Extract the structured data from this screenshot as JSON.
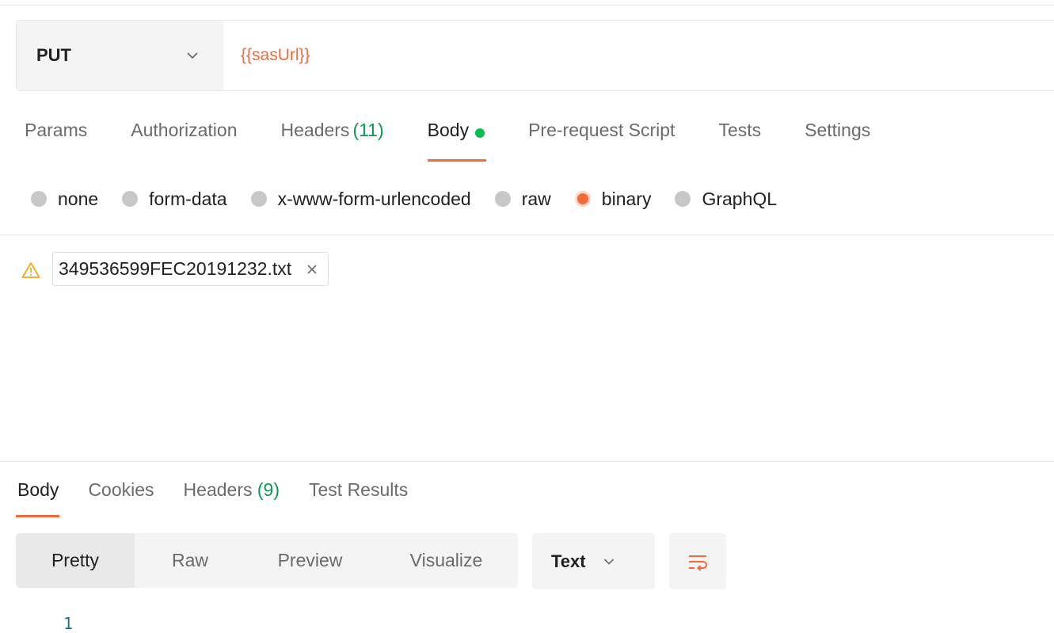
{
  "request": {
    "method": "PUT",
    "url": "{{sasUrl}}"
  },
  "request_tabs": [
    {
      "label": "Params",
      "count": ""
    },
    {
      "label": "Authorization",
      "count": ""
    },
    {
      "label": "Headers",
      "count": "(11)"
    },
    {
      "label": "Body",
      "count": "",
      "active": true
    },
    {
      "label": "Pre-request Script",
      "count": ""
    },
    {
      "label": "Tests",
      "count": ""
    },
    {
      "label": "Settings",
      "count": ""
    }
  ],
  "body_types": [
    "none",
    "form-data",
    "x-www-form-urlencoded",
    "raw",
    "binary",
    "GraphQL"
  ],
  "body_type_selected": "binary",
  "file": {
    "name": "349536599FEC20191232.txt"
  },
  "response_tabs": [
    {
      "label": "Body",
      "count": ""
    },
    {
      "label": "Cookies",
      "count": ""
    },
    {
      "label": "Headers",
      "count": "(9)"
    },
    {
      "label": "Test Results",
      "count": ""
    }
  ],
  "view_modes": [
    "Pretty",
    "Raw",
    "Preview",
    "Visualize"
  ],
  "format": "Text",
  "line_number": "1",
  "colors": {
    "accent": "#f26b3a",
    "success": "#0a9b52",
    "warning": "#f5a623"
  },
  "icons": {
    "method_dropdown": "chevron-down-icon",
    "body_dot": "green-dot-indicator",
    "file_warning": "warning-triangle-icon",
    "file_remove": "close-icon",
    "format_dropdown": "chevron-down-icon",
    "wrap": "wrap-lines-icon"
  }
}
